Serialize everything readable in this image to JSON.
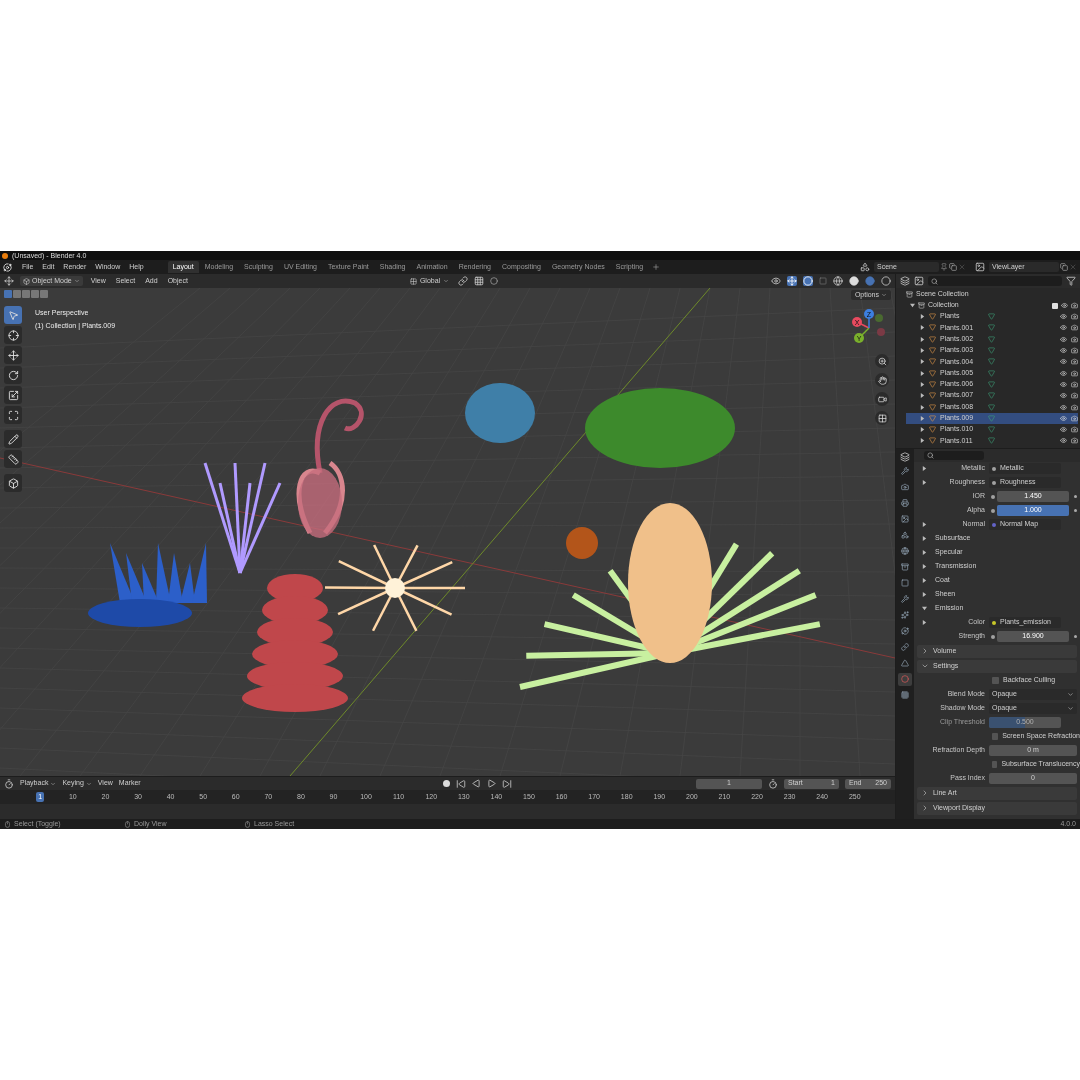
{
  "window": {
    "title": "(Unsaved) - Blender 4.0"
  },
  "menu": [
    "File",
    "Edit",
    "Render",
    "Window",
    "Help"
  ],
  "workspaces": [
    {
      "label": "Layout",
      "selected": true
    },
    {
      "label": "Modeling",
      "selected": false
    },
    {
      "label": "Sculpting",
      "selected": false
    },
    {
      "label": "UV Editing",
      "selected": false
    },
    {
      "label": "Texture Paint",
      "selected": false
    },
    {
      "label": "Shading",
      "selected": false
    },
    {
      "label": "Animation",
      "selected": false
    },
    {
      "label": "Rendering",
      "selected": false
    },
    {
      "label": "Compositing",
      "selected": false
    },
    {
      "label": "Geometry Nodes",
      "selected": false
    },
    {
      "label": "Scripting",
      "selected": false
    }
  ],
  "scene": "Scene",
  "view_layer": "ViewLayer",
  "viewport_header": {
    "mode": "Object Mode",
    "menus": [
      "View",
      "Select",
      "Add",
      "Object"
    ],
    "orientation": "Global",
    "options": "Options"
  },
  "viewport": {
    "view_name": "User Perspective",
    "active_object": "(1) Collection | Plants.009",
    "gizmo_axes": [
      "X",
      "Y",
      "Z"
    ],
    "tools": [
      {
        "kind": "select",
        "selected": true
      },
      {
        "kind": "cursor",
        "selected": false
      },
      {
        "kind": "move",
        "selected": false
      },
      {
        "kind": "rotate",
        "selected": false
      },
      {
        "kind": "scale",
        "selected": false
      },
      {
        "kind": "transform",
        "selected": false
      },
      {
        "kind": "annotate",
        "selected": false
      },
      {
        "kind": "measure",
        "selected": false
      },
      {
        "kind": "add",
        "selected": false
      }
    ]
  },
  "outliner": {
    "root": "Scene Collection",
    "collection": {
      "name": "Collection",
      "expanded": true,
      "checked": true,
      "children": [
        {
          "name": "Plants",
          "selected": false
        },
        {
          "name": "Plants.001",
          "selected": false
        },
        {
          "name": "Plants.002",
          "selected": false
        },
        {
          "name": "Plants.003",
          "selected": false
        },
        {
          "name": "Plants.004",
          "selected": false
        },
        {
          "name": "Plants.005",
          "selected": false
        },
        {
          "name": "Plants.006",
          "selected": false
        },
        {
          "name": "Plants.007",
          "selected": false
        },
        {
          "name": "Plants.008",
          "selected": false
        },
        {
          "name": "Plants.009",
          "selected": true
        },
        {
          "name": "Plants.010",
          "selected": false
        },
        {
          "name": "Plants.011",
          "selected": false
        }
      ]
    }
  },
  "properties": {
    "tabs": [
      {
        "kind": "tool",
        "selected": false
      },
      {
        "kind": "render",
        "selected": false
      },
      {
        "kind": "output",
        "selected": false
      },
      {
        "kind": "view-layer",
        "selected": false
      },
      {
        "kind": "scene",
        "selected": false
      },
      {
        "kind": "world",
        "selected": false
      },
      {
        "kind": "collection",
        "selected": false
      },
      {
        "kind": "object",
        "selected": false
      },
      {
        "kind": "modifier",
        "selected": false
      },
      {
        "kind": "particles",
        "selected": false
      },
      {
        "kind": "physics",
        "selected": false
      },
      {
        "kind": "constraints",
        "selected": false
      },
      {
        "kind": "data",
        "selected": false
      },
      {
        "kind": "material",
        "selected": true
      },
      {
        "kind": "texture",
        "selected": false
      }
    ],
    "rows": [
      {
        "kind": "link",
        "label": "Metallic",
        "value": "Metallic",
        "color": "#a1a1a1"
      },
      {
        "kind": "link",
        "label": "Roughness",
        "value": "Roughness",
        "color": "#a1a1a1"
      },
      {
        "kind": "number",
        "label": "IOR",
        "value": "1.450",
        "color": "#a1a1a1"
      },
      {
        "kind": "slider",
        "label": "Alpha",
        "value": "1.000",
        "color": "#a1a1a1",
        "level": 1,
        "disabled": false
      },
      {
        "kind": "link",
        "label": "Normal",
        "value": "Normal Map",
        "color": "#6363c7"
      },
      {
        "kind": "section",
        "label": "Subsurface",
        "expanded": false
      },
      {
        "kind": "section",
        "label": "Specular",
        "expanded": false
      },
      {
        "kind": "section",
        "label": "Transmission",
        "expanded": false
      },
      {
        "kind": "section",
        "label": "Coat",
        "expanded": false
      },
      {
        "kind": "section",
        "label": "Sheen",
        "expanded": false
      },
      {
        "kind": "section",
        "label": "Emission",
        "expanded": true
      },
      {
        "kind": "link",
        "label": "Color",
        "value": "Plants_emission",
        "color": "#c7c729"
      },
      {
        "kind": "number",
        "label": "Strength",
        "value": "16.900",
        "color": "#a1a1a1"
      },
      {
        "kind": "panel",
        "label": "Volume",
        "expanded": false
      },
      {
        "kind": "panel",
        "label": "Settings",
        "expanded": true
      },
      {
        "kind": "checkbox",
        "label": "Backface Culling",
        "checked": false
      },
      {
        "kind": "select",
        "label": "Blend Mode",
        "value": "Opaque"
      },
      {
        "kind": "select",
        "label": "Shadow Mode",
        "value": "Opaque"
      },
      {
        "kind": "slider",
        "label": "Clip Threshold",
        "value": "0.500",
        "level": 0.5,
        "disabled": true
      },
      {
        "kind": "checkbox",
        "label": "Screen Space Refraction",
        "checked": false
      },
      {
        "kind": "field",
        "label": "Refraction Depth",
        "value": "0 m"
      },
      {
        "kind": "checkbox",
        "label": "Subsurface Translucency",
        "checked": false
      },
      {
        "kind": "field",
        "label": "Pass Index",
        "value": "0"
      },
      {
        "kind": "panel",
        "label": "Line Art",
        "expanded": false
      },
      {
        "kind": "panel",
        "label": "Viewport Display",
        "expanded": false
      }
    ]
  },
  "timeline": {
    "menus": [
      "Playback",
      "Keying",
      "View",
      "Marker"
    ],
    "current_frame": "1",
    "start_label": "Start",
    "start": "1",
    "end_label": "End",
    "end": "250",
    "ruler": [
      {
        "label": "1",
        "selected": true
      },
      {
        "label": "10",
        "selected": false
      },
      {
        "label": "20",
        "selected": false
      },
      {
        "label": "30",
        "selected": false
      },
      {
        "label": "40",
        "selected": false
      },
      {
        "label": "50",
        "selected": false
      },
      {
        "label": "60",
        "selected": false
      },
      {
        "label": "70",
        "selected": false
      },
      {
        "label": "80",
        "selected": false
      },
      {
        "label": "90",
        "selected": false
      },
      {
        "label": "100",
        "selected": false
      },
      {
        "label": "110",
        "selected": false
      },
      {
        "label": "120",
        "selected": false
      },
      {
        "label": "130",
        "selected": false
      },
      {
        "label": "140",
        "selected": false
      },
      {
        "label": "150",
        "selected": false
      },
      {
        "label": "160",
        "selected": false
      },
      {
        "label": "170",
        "selected": false
      },
      {
        "label": "180",
        "selected": false
      },
      {
        "label": "190",
        "selected": false
      },
      {
        "label": "200",
        "selected": false
      },
      {
        "label": "210",
        "selected": false
      },
      {
        "label": "220",
        "selected": false
      },
      {
        "label": "230",
        "selected": false
      },
      {
        "label": "240",
        "selected": false
      },
      {
        "label": "250",
        "selected": false
      }
    ]
  },
  "status_bar": {
    "hints": [
      "Select (Toggle)",
      "Dolly View",
      "Lasso Select"
    ],
    "version": "4.0.0"
  }
}
